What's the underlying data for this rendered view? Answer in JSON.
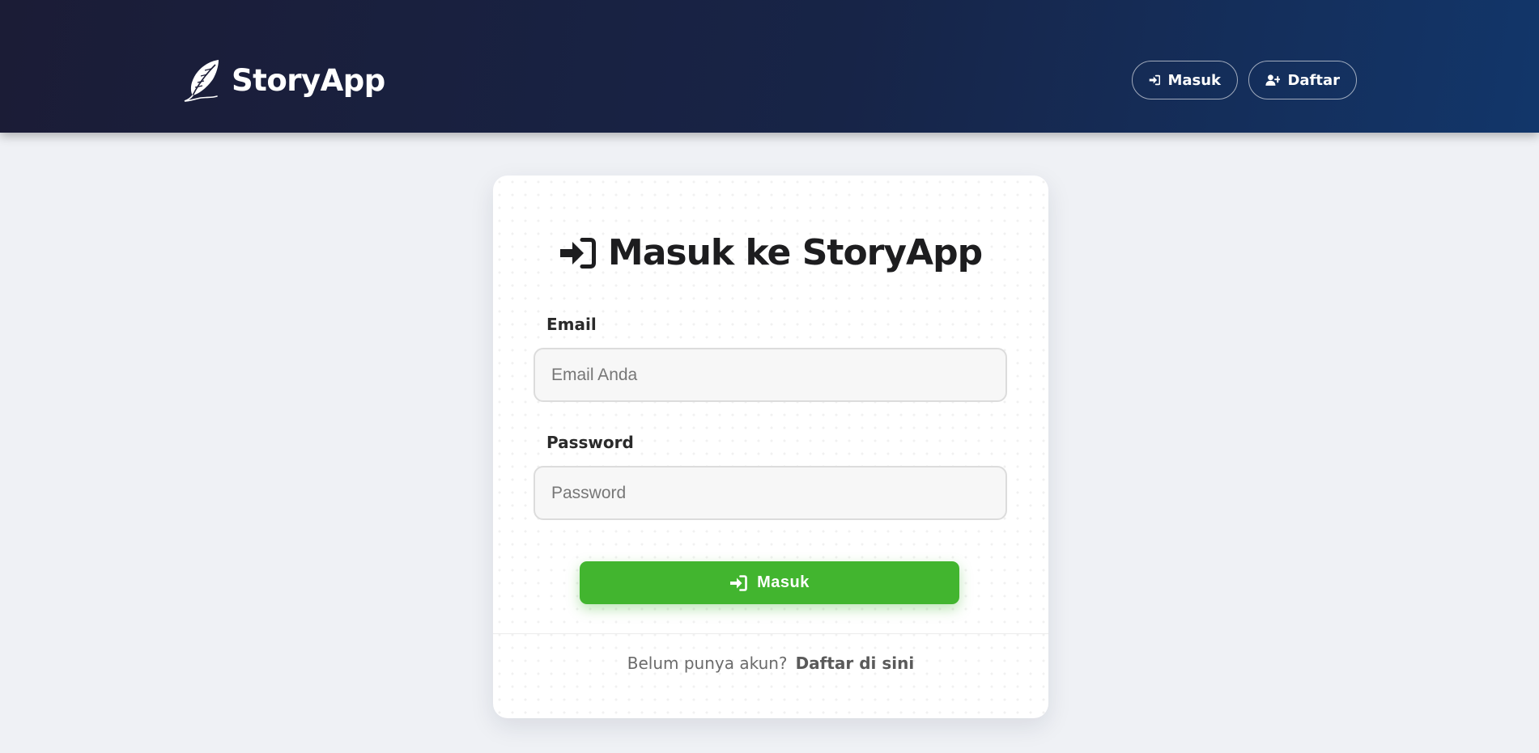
{
  "header": {
    "brand_icon": "feather-icon",
    "brand_title": "StoryApp",
    "nav": {
      "login_label": "Masuk",
      "login_icon": "sign-in-icon",
      "register_label": "Daftar",
      "register_icon": "user-plus-icon"
    }
  },
  "login_card": {
    "title": "Masuk ke StoryApp",
    "title_icon": "sign-in-icon",
    "email_label": "Email",
    "email_placeholder": "Email Anda",
    "email_value": "",
    "password_label": "Password",
    "password_placeholder": "Password",
    "password_value": "",
    "submit_label": "Masuk",
    "submit_icon": "sign-in-icon",
    "register_prompt": "Belum punya akun?",
    "register_link": "Daftar di sini"
  },
  "colors": {
    "header_gradient_start": "#1b1c36",
    "header_gradient_end": "#12366a",
    "page_background": "#eff1f5",
    "accent_green": "#42b52f",
    "title_text": "#1d1d1f"
  }
}
